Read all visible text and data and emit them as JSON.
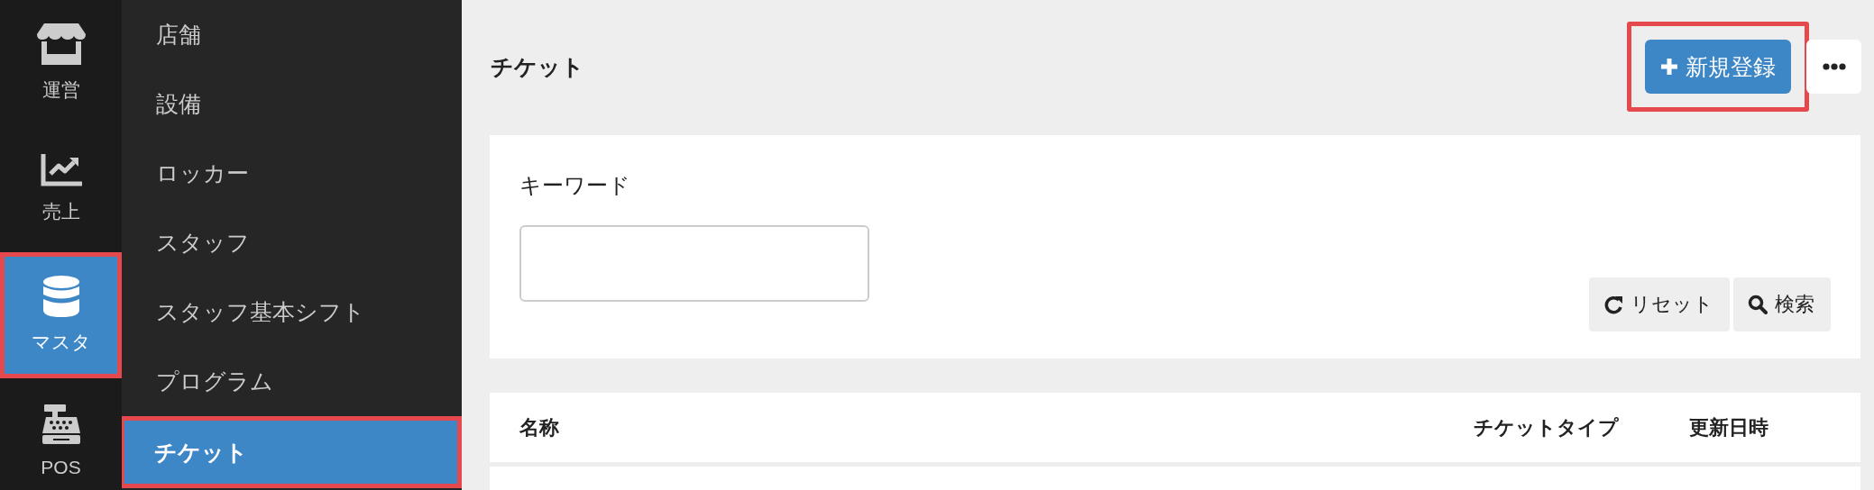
{
  "rail": {
    "items": [
      {
        "label": "運営",
        "kind": "store",
        "selected": false,
        "highlighted": false
      },
      {
        "label": "売上",
        "kind": "chart",
        "selected": false,
        "highlighted": false
      },
      {
        "label": "マスタ",
        "kind": "database",
        "selected": true,
        "highlighted": true
      },
      {
        "label": "POS",
        "kind": "register",
        "selected": false,
        "highlighted": false
      }
    ]
  },
  "submenu": {
    "items": [
      {
        "label": "店舗",
        "selected": false,
        "highlighted": false
      },
      {
        "label": "設備",
        "selected": false,
        "highlighted": false
      },
      {
        "label": "ロッカー",
        "selected": false,
        "highlighted": false
      },
      {
        "label": "スタッフ",
        "selected": false,
        "highlighted": false
      },
      {
        "label": "スタッフ基本シフト",
        "selected": false,
        "highlighted": false
      },
      {
        "label": "プログラム",
        "selected": false,
        "highlighted": false
      },
      {
        "label": "チケット",
        "selected": true,
        "highlighted": true
      }
    ]
  },
  "page": {
    "title": "チケット",
    "new_button": {
      "label": "新規登録",
      "highlighted": true
    }
  },
  "search": {
    "label": "キーワード",
    "buttons": [
      {
        "label": "リセット",
        "kind": "reset"
      },
      {
        "label": "検索",
        "kind": "search"
      }
    ]
  },
  "table": {
    "columns": [
      "名称",
      "チケットタイプ",
      "更新日時"
    ]
  }
}
